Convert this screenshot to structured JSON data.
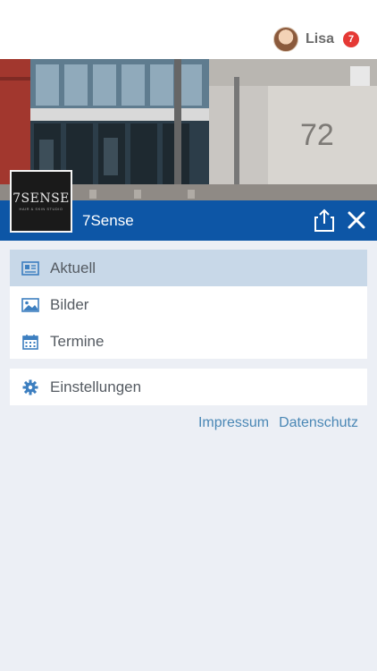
{
  "header": {
    "user_name": "Lisa",
    "notification_count": "7"
  },
  "logo": {
    "text": "7SENSE",
    "subtext": "HAIR & SKIN STUDIO"
  },
  "titlebar": {
    "title": "7Sense"
  },
  "menu": {
    "main": [
      {
        "label": "Aktuell",
        "icon": "newspaper-icon",
        "active": true
      },
      {
        "label": "Bilder",
        "icon": "image-icon",
        "active": false
      },
      {
        "label": "Termine",
        "icon": "calendar-icon",
        "active": false
      }
    ],
    "settings": {
      "label": "Einstellungen",
      "icon": "gear-icon"
    }
  },
  "footer": {
    "impressum": "Impressum",
    "datenschutz": "Datenschutz"
  },
  "colors": {
    "accent": "#0d56a6",
    "active_item": "#c8d8e8",
    "badge": "#e53935",
    "link": "#4a87b5"
  }
}
